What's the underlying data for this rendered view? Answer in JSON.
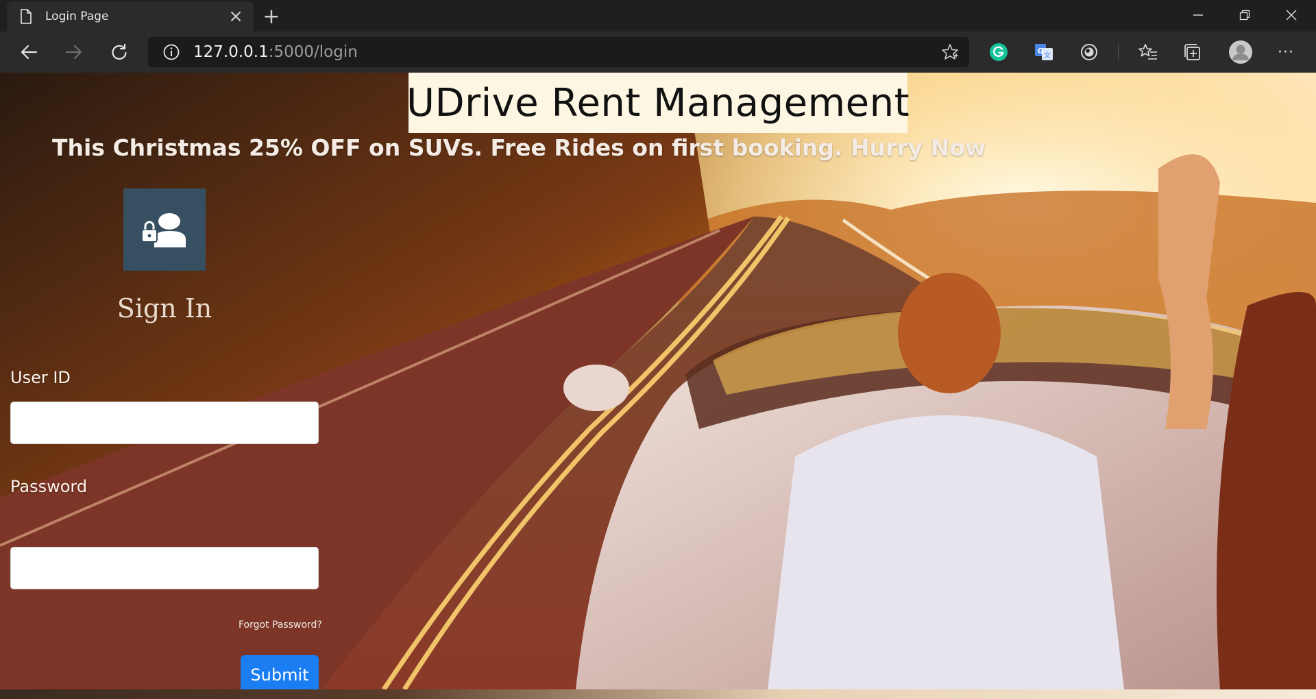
{
  "browser": {
    "tab": {
      "title": "Login Page",
      "close_glyph": "×"
    },
    "new_tab_glyph": "+",
    "address": {
      "host": "127.0.0.1",
      "rest": ":5000/login"
    },
    "icons": {
      "favicon": "page-icon",
      "info": "info-icon",
      "favorite": "star-icon",
      "back": "back-arrow-icon",
      "forward": "forward-arrow-icon",
      "reload": "reload-icon",
      "extensions": [
        "grammarly-icon",
        "translate-icon",
        "extension-icon"
      ],
      "favorites_bar": "favorites-icon",
      "collections": "collections-icon",
      "profile": "profile-avatar-icon",
      "menu": "more-icon",
      "window": [
        "minimize-icon",
        "restore-icon",
        "close-icon"
      ]
    },
    "menu_glyph": "···"
  },
  "page": {
    "title": "UDrive Rent Management",
    "promo": "This Christmas 25% OFF on SUVs. Free Rides on first booking. Hurry Now",
    "signin_heading": "Sign In",
    "form": {
      "userid_label": "User ID",
      "userid_value": "",
      "password_label": "Password",
      "password_value": "",
      "forgot_link": "Forgot Password?",
      "submit_label": "Submit"
    }
  },
  "colors": {
    "title_bg": "#fdf6e3",
    "avatar_tile": "#364f61",
    "submit": "#1a7ef2",
    "grammarly": "#15c39a"
  }
}
